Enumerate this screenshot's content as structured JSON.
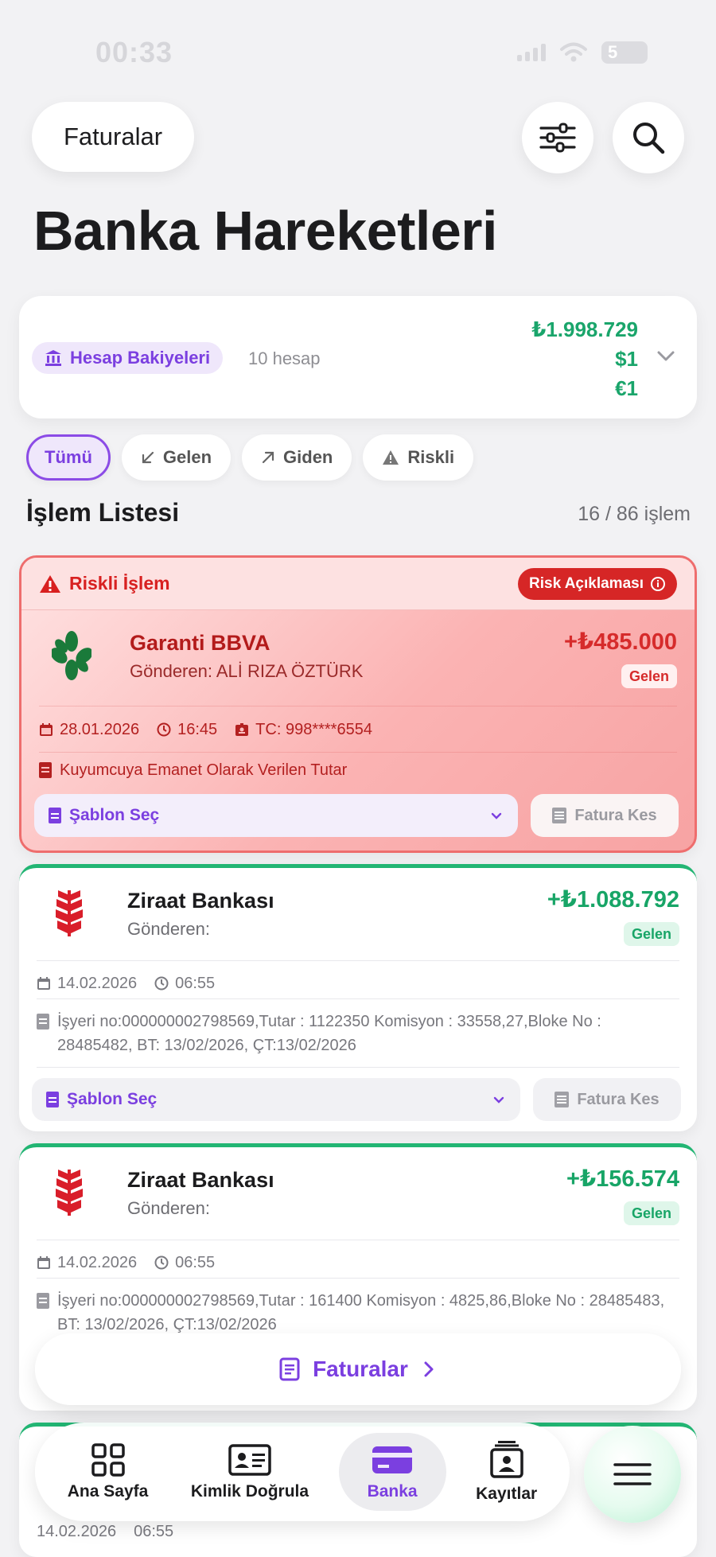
{
  "status": {
    "time": "00:33",
    "battery": "5"
  },
  "header": {
    "back_label": "Faturalar",
    "title": "Banka Hareketleri"
  },
  "balance": {
    "label": "Hesap Bakiyeleri",
    "account_count": "10 hesap",
    "try": "₺1.998.729",
    "usd": "$1",
    "eur": "€1"
  },
  "filters": [
    {
      "label": "Tümü",
      "active": true
    },
    {
      "label": "Gelen",
      "icon": "arrow-down-left-icon"
    },
    {
      "label": "Giden",
      "icon": "arrow-up-right-icon"
    },
    {
      "label": "Riskli",
      "icon": "warning-icon"
    }
  ],
  "list": {
    "title": "İşlem Listesi",
    "count": "16 / 86 işlem"
  },
  "transactions": [
    {
      "risk_title": "Riskli İşlem",
      "risk_button": "Risk Açıklaması",
      "bank": "Garanti BBVA",
      "sender": "Gönderen: ALİ RIZA ÖZTÜRK",
      "amount": "+₺485.000",
      "direction": "Gelen",
      "date": "28.01.2026",
      "time": "16:45",
      "tc": "TC: 998****6554",
      "description": "Kuyumcuya Emanet Olarak Verilen Tutar",
      "template": "Şablon Seç",
      "invoice": "Fatura Kes"
    },
    {
      "bank": "Ziraat Bankası",
      "sender": "Gönderen:",
      "amount": "+₺1.088.792",
      "direction": "Gelen",
      "date": "14.02.2026",
      "time": "06:55",
      "description": "İşyeri no:000000002798569,Tutar : 1122350 Komisyon : 33558,27,Bloke No : 28485482, BT: 13/02/2026, ÇT:13/02/2026",
      "template": "Şablon Seç",
      "invoice": "Fatura Kes"
    },
    {
      "bank": "Ziraat Bankası",
      "sender": "Gönderen:",
      "amount": "+₺156.574",
      "direction": "Gelen",
      "date": "14.02.2026",
      "time": "06:55",
      "description": "İşyeri no:000000002798569,Tutar : 161400 Komisyon : 4825,86,Bloke No : 28485483, BT: 13/02/2026, ÇT:13/02/2026",
      "template": "Şablon Seç",
      "invoice": "Fatura Kes"
    },
    {
      "date": "14.02.2026",
      "time": "06:55"
    }
  ],
  "floating": {
    "label": "Faturalar"
  },
  "tabs": [
    {
      "label": "Ana Sayfa",
      "icon": "grid-icon"
    },
    {
      "label": "Kimlik Doğrula",
      "icon": "id-card-icon"
    },
    {
      "label": "Banka",
      "icon": "card-icon",
      "active": true
    },
    {
      "label": "Kayıtlar",
      "icon": "records-icon"
    }
  ],
  "colors": {
    "accent": "#7b3fe0",
    "income": "#18a567",
    "risk": "#d62626"
  }
}
